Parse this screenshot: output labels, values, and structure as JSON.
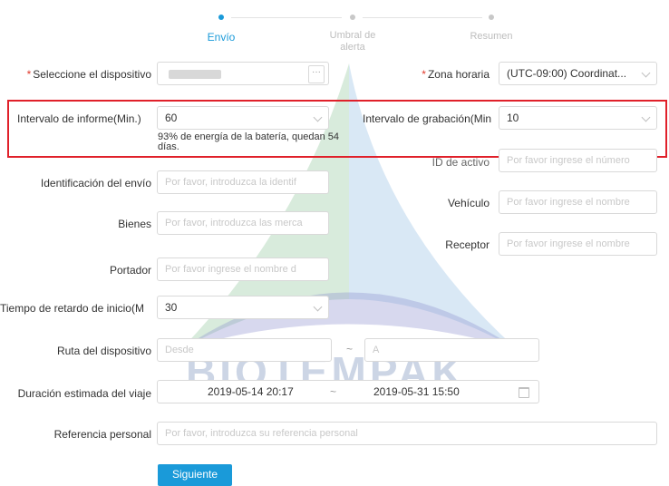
{
  "steps": [
    {
      "label": "Envío",
      "active": true
    },
    {
      "label": "Umbral de alerta",
      "active": false
    },
    {
      "label": "Resumen",
      "active": false
    }
  ],
  "watermark": "BIOTEMPAK",
  "form": {
    "device": {
      "label": "Seleccione el dispositivo",
      "required_mark": "*",
      "button": "···"
    },
    "timezone": {
      "label": "Zona horaria",
      "required_mark": "*",
      "value": "(UTC-09:00) Coordinat..."
    },
    "report_interval": {
      "label": "Intervalo de informe(Min.)",
      "value": "60",
      "hint": "93% de energía de la batería, quedan 54 días."
    },
    "record_interval": {
      "label": "Intervalo de grabación(Min",
      "value": "10"
    },
    "asset_id": {
      "label": "ID de activo",
      "placeholder": "Por favor ingrese el número"
    },
    "shipment_id": {
      "label": "Identificación del envío",
      "placeholder": "Por favor, introduzca la identif"
    },
    "vehicle": {
      "label": "Vehículo",
      "placeholder": "Por favor ingrese el nombre"
    },
    "goods": {
      "label": "Bienes",
      "placeholder": "Por favor, introduzca las merca"
    },
    "receiver": {
      "label": "Receptor",
      "placeholder": "Por favor ingrese el nombre"
    },
    "carrier": {
      "label": "Portador",
      "placeholder": "Por favor ingrese el nombre d"
    },
    "start_delay": {
      "label": "Tiempo de retardo de inicio(M",
      "value": "30"
    },
    "route": {
      "label": "Ruta del dispositivo",
      "from_placeholder": "Desde",
      "separator": "~",
      "to_placeholder": "A"
    },
    "duration": {
      "label": "Duración estimada del viaje",
      "start": "2019-05-14 20:17",
      "separator": "~",
      "end": "2019-05-31 15:50"
    },
    "reference": {
      "label": "Referencia personal",
      "placeholder": "Por favor, introduzca su referencia personal"
    }
  },
  "next_button": "Siguiente",
  "colors": {
    "accent": "#1a9ad9",
    "highlight": "#e0202a",
    "button": "#1a9ad9"
  }
}
